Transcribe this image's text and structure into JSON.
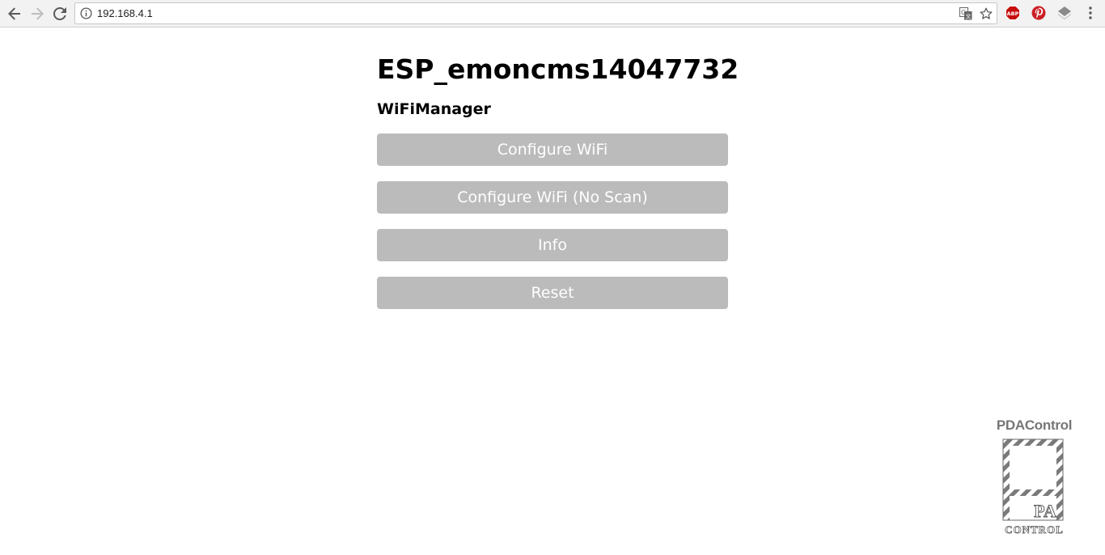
{
  "browser": {
    "url": "192.168.4.1",
    "icons": {
      "back": "arrow-left-icon",
      "forward": "arrow-right-icon",
      "reload": "reload-icon",
      "info": "info-icon",
      "translate": "translate-icon",
      "bookmark": "star-icon",
      "adblock": "abp-icon",
      "pinterest": "pinterest-icon",
      "layers": "layers-icon",
      "menu": "kebab-menu-icon"
    },
    "adblock_label": "ABP",
    "colors": {
      "adblock": "#c70d0d",
      "pinterest": "#cb2027"
    }
  },
  "page": {
    "title": "ESP_emoncms14047732",
    "subtitle": "WiFiManager",
    "buttons": [
      {
        "label": "Configure WiFi"
      },
      {
        "label": "Configure WiFi (No Scan)"
      },
      {
        "label": "Info"
      },
      {
        "label": "Reset"
      }
    ],
    "button_color": "#bbbbbb"
  },
  "watermark": {
    "brand": "PDAControl",
    "sub": "CONTROL",
    "letters": "PA"
  }
}
